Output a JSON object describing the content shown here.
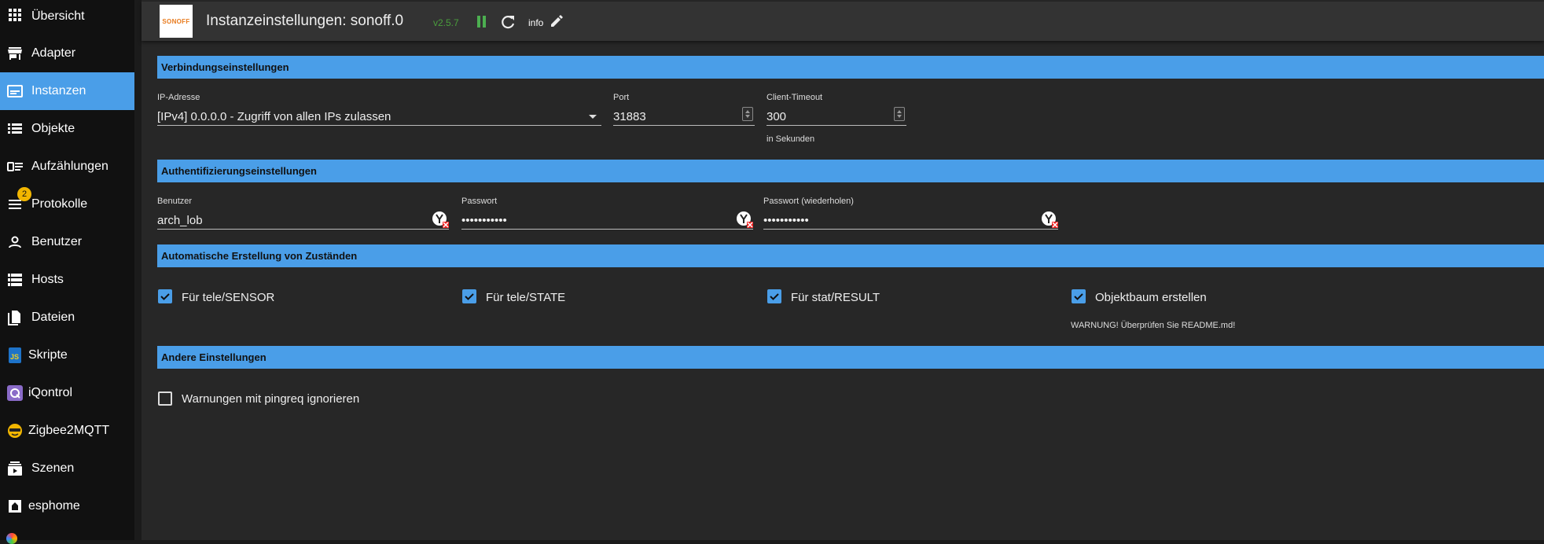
{
  "sidebar": {
    "items": [
      {
        "label": "Übersicht",
        "icon": "grid-icon"
      },
      {
        "label": "Adapter",
        "icon": "store-icon"
      },
      {
        "label": "Instanzen",
        "icon": "instances-icon"
      },
      {
        "label": "Objekte",
        "icon": "list-icon"
      },
      {
        "label": "Aufzählungen",
        "icon": "enum-icon"
      },
      {
        "label": "Protokolle",
        "icon": "log-icon",
        "badge": "2"
      },
      {
        "label": "Benutzer",
        "icon": "user-icon"
      },
      {
        "label": "Hosts",
        "icon": "hosts-icon"
      },
      {
        "label": "Dateien",
        "icon": "files-icon"
      },
      {
        "label": "Skripte",
        "icon": "js-icon"
      },
      {
        "label": "iQontrol",
        "icon": "iqontrol-icon"
      },
      {
        "label": "Zigbee2MQTT",
        "icon": "zigbee-icon"
      },
      {
        "label": "Szenen",
        "icon": "scenes-icon"
      },
      {
        "label": "esphome",
        "icon": "esphome-icon"
      }
    ]
  },
  "header": {
    "logo_text": "SONOFF",
    "title": "Instanzeinstellungen: sonoff.0",
    "version": "v2.5.7",
    "info": "info"
  },
  "sections": {
    "connection": "Verbindungseinstellungen",
    "auth": "Authentifizierungseinstellungen",
    "auto": "Automatische Erstellung von Zuständen",
    "other": "Andere Einstellungen"
  },
  "connection": {
    "ip_label": "IP-Adresse",
    "ip_value": "[IPv4] 0.0.0.0 - Zugriff von allen IPs zulassen",
    "port_label": "Port",
    "port_value": "31883",
    "timeout_label": "Client-Timeout",
    "timeout_value": "300",
    "timeout_helper": "in Sekunden"
  },
  "auth": {
    "user_label": "Benutzer",
    "user_value": "arch_lob",
    "pw_label": "Passwort",
    "pw_value": "•••••••••••",
    "pw2_label": "Passwort (wiederholen)",
    "pw2_value": "•••••••••••"
  },
  "auto": {
    "sensor": "Für tele/SENSOR",
    "state": "Für tele/STATE",
    "result": "Für stat/RESULT",
    "tree": "Objektbaum erstellen",
    "warning": "WARNUNG! Überprüfen Sie README.md!"
  },
  "other": {
    "pingreq": "Warnungen mit pingreq ignorieren"
  },
  "colors": {
    "accent": "#4a9ee8",
    "badge": "#f2b600",
    "version": "#4a9e3c",
    "pause": "#4caf50"
  }
}
